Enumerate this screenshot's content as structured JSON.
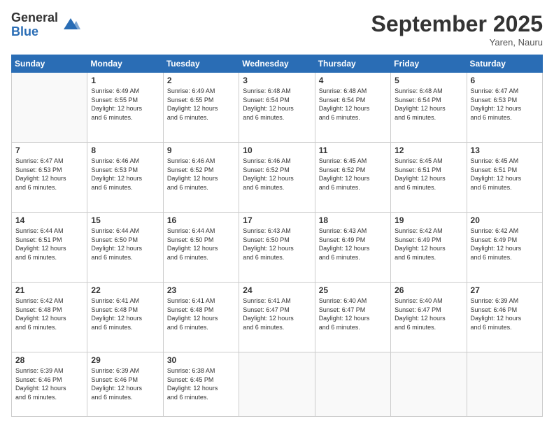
{
  "logo": {
    "general": "General",
    "blue": "Blue"
  },
  "header": {
    "month": "September 2025",
    "location": "Yaren, Nauru"
  },
  "days_of_week": [
    "Sunday",
    "Monday",
    "Tuesday",
    "Wednesday",
    "Thursday",
    "Friday",
    "Saturday"
  ],
  "weeks": [
    [
      {
        "day": "",
        "info": ""
      },
      {
        "day": "1",
        "info": "Sunrise: 6:49 AM\nSunset: 6:55 PM\nDaylight: 12 hours\nand 6 minutes."
      },
      {
        "day": "2",
        "info": "Sunrise: 6:49 AM\nSunset: 6:55 PM\nDaylight: 12 hours\nand 6 minutes."
      },
      {
        "day": "3",
        "info": "Sunrise: 6:48 AM\nSunset: 6:54 PM\nDaylight: 12 hours\nand 6 minutes."
      },
      {
        "day": "4",
        "info": "Sunrise: 6:48 AM\nSunset: 6:54 PM\nDaylight: 12 hours\nand 6 minutes."
      },
      {
        "day": "5",
        "info": "Sunrise: 6:48 AM\nSunset: 6:54 PM\nDaylight: 12 hours\nand 6 minutes."
      },
      {
        "day": "6",
        "info": "Sunrise: 6:47 AM\nSunset: 6:53 PM\nDaylight: 12 hours\nand 6 minutes."
      }
    ],
    [
      {
        "day": "7",
        "info": "Sunrise: 6:47 AM\nSunset: 6:53 PM\nDaylight: 12 hours\nand 6 minutes."
      },
      {
        "day": "8",
        "info": "Sunrise: 6:46 AM\nSunset: 6:53 PM\nDaylight: 12 hours\nand 6 minutes."
      },
      {
        "day": "9",
        "info": "Sunrise: 6:46 AM\nSunset: 6:52 PM\nDaylight: 12 hours\nand 6 minutes."
      },
      {
        "day": "10",
        "info": "Sunrise: 6:46 AM\nSunset: 6:52 PM\nDaylight: 12 hours\nand 6 minutes."
      },
      {
        "day": "11",
        "info": "Sunrise: 6:45 AM\nSunset: 6:52 PM\nDaylight: 12 hours\nand 6 minutes."
      },
      {
        "day": "12",
        "info": "Sunrise: 6:45 AM\nSunset: 6:51 PM\nDaylight: 12 hours\nand 6 minutes."
      },
      {
        "day": "13",
        "info": "Sunrise: 6:45 AM\nSunset: 6:51 PM\nDaylight: 12 hours\nand 6 minutes."
      }
    ],
    [
      {
        "day": "14",
        "info": "Sunrise: 6:44 AM\nSunset: 6:51 PM\nDaylight: 12 hours\nand 6 minutes."
      },
      {
        "day": "15",
        "info": "Sunrise: 6:44 AM\nSunset: 6:50 PM\nDaylight: 12 hours\nand 6 minutes."
      },
      {
        "day": "16",
        "info": "Sunrise: 6:44 AM\nSunset: 6:50 PM\nDaylight: 12 hours\nand 6 minutes."
      },
      {
        "day": "17",
        "info": "Sunrise: 6:43 AM\nSunset: 6:50 PM\nDaylight: 12 hours\nand 6 minutes."
      },
      {
        "day": "18",
        "info": "Sunrise: 6:43 AM\nSunset: 6:49 PM\nDaylight: 12 hours\nand 6 minutes."
      },
      {
        "day": "19",
        "info": "Sunrise: 6:42 AM\nSunset: 6:49 PM\nDaylight: 12 hours\nand 6 minutes."
      },
      {
        "day": "20",
        "info": "Sunrise: 6:42 AM\nSunset: 6:49 PM\nDaylight: 12 hours\nand 6 minutes."
      }
    ],
    [
      {
        "day": "21",
        "info": "Sunrise: 6:42 AM\nSunset: 6:48 PM\nDaylight: 12 hours\nand 6 minutes."
      },
      {
        "day": "22",
        "info": "Sunrise: 6:41 AM\nSunset: 6:48 PM\nDaylight: 12 hours\nand 6 minutes."
      },
      {
        "day": "23",
        "info": "Sunrise: 6:41 AM\nSunset: 6:48 PM\nDaylight: 12 hours\nand 6 minutes."
      },
      {
        "day": "24",
        "info": "Sunrise: 6:41 AM\nSunset: 6:47 PM\nDaylight: 12 hours\nand 6 minutes."
      },
      {
        "day": "25",
        "info": "Sunrise: 6:40 AM\nSunset: 6:47 PM\nDaylight: 12 hours\nand 6 minutes."
      },
      {
        "day": "26",
        "info": "Sunrise: 6:40 AM\nSunset: 6:47 PM\nDaylight: 12 hours\nand 6 minutes."
      },
      {
        "day": "27",
        "info": "Sunrise: 6:39 AM\nSunset: 6:46 PM\nDaylight: 12 hours\nand 6 minutes."
      }
    ],
    [
      {
        "day": "28",
        "info": "Sunrise: 6:39 AM\nSunset: 6:46 PM\nDaylight: 12 hours\nand 6 minutes."
      },
      {
        "day": "29",
        "info": "Sunrise: 6:39 AM\nSunset: 6:46 PM\nDaylight: 12 hours\nand 6 minutes."
      },
      {
        "day": "30",
        "info": "Sunrise: 6:38 AM\nSunset: 6:45 PM\nDaylight: 12 hours\nand 6 minutes."
      },
      {
        "day": "",
        "info": ""
      },
      {
        "day": "",
        "info": ""
      },
      {
        "day": "",
        "info": ""
      },
      {
        "day": "",
        "info": ""
      }
    ]
  ]
}
